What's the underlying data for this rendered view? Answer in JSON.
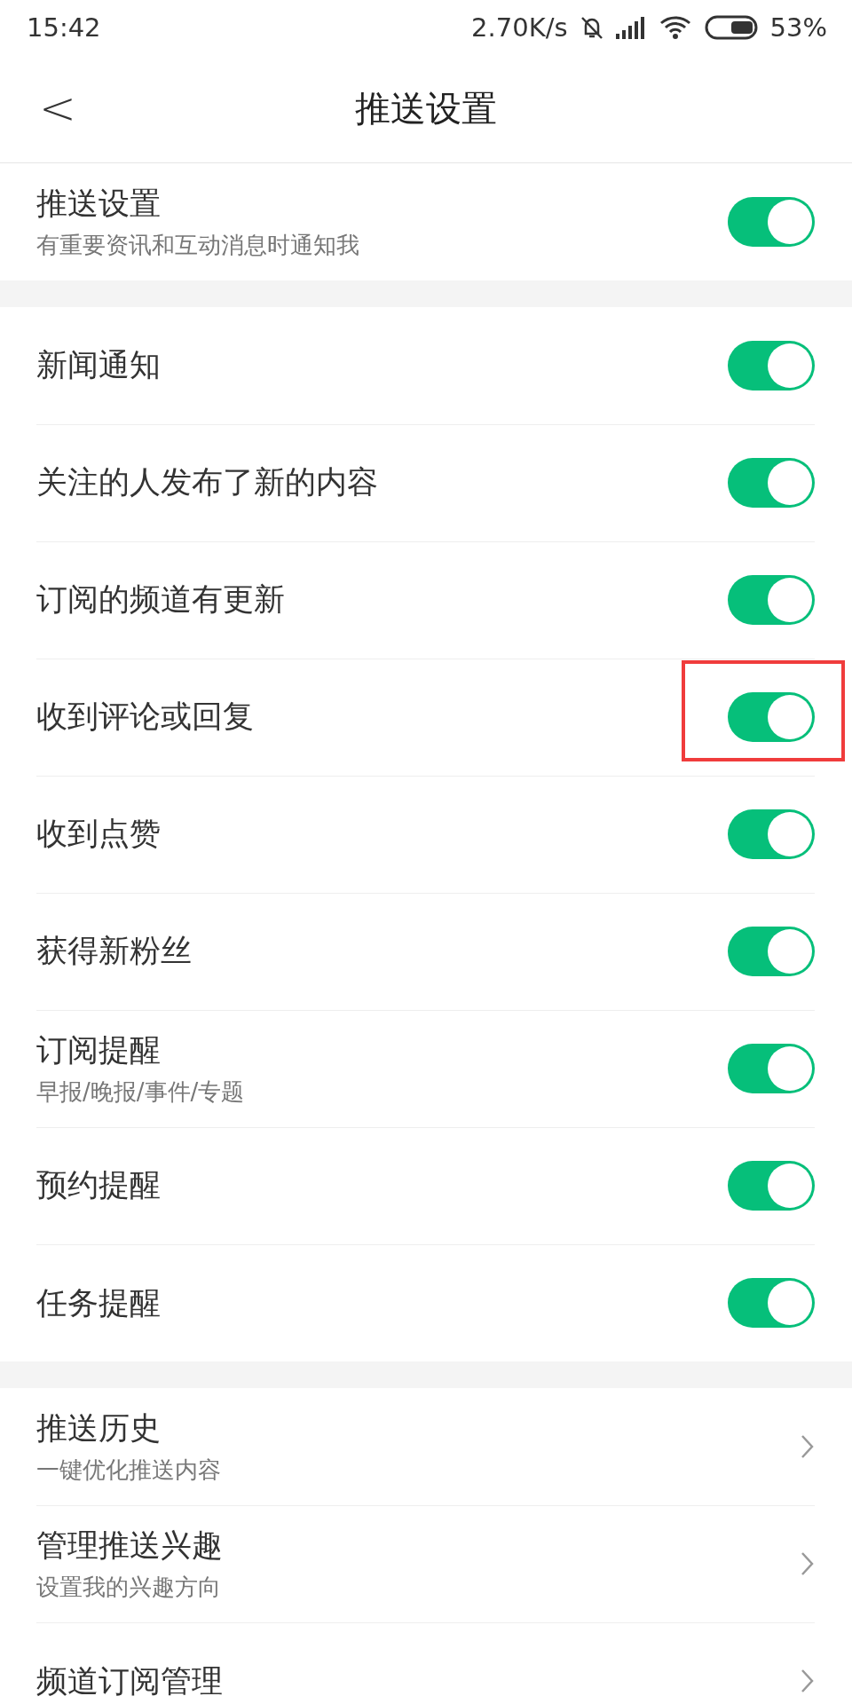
{
  "status_bar": {
    "time": "15:42",
    "speed": "2.70K/s",
    "battery": "53%"
  },
  "header": {
    "back": "<",
    "title": "推送设置"
  },
  "master": {
    "title": "推送设置",
    "subtitle": "有重要资讯和互动消息时通知我",
    "on": true
  },
  "toggles": [
    {
      "title": "新闻通知",
      "on": true,
      "highlighted": false
    },
    {
      "title": "关注的人发布了新的内容",
      "on": true,
      "highlighted": false
    },
    {
      "title": "订阅的频道有更新",
      "on": true,
      "highlighted": false
    },
    {
      "title": "收到评论或回复",
      "on": true,
      "highlighted": true
    },
    {
      "title": "收到点赞",
      "on": true,
      "highlighted": false
    },
    {
      "title": "获得新粉丝",
      "on": true,
      "highlighted": false
    },
    {
      "title": "订阅提醒",
      "subtitle": "早报/晚报/事件/专题",
      "on": true,
      "highlighted": false
    },
    {
      "title": "预约提醒",
      "on": true,
      "highlighted": false
    },
    {
      "title": "任务提醒",
      "on": true,
      "highlighted": false
    }
  ],
  "links": [
    {
      "title": "推送历史",
      "subtitle": "一键优化推送内容"
    },
    {
      "title": "管理推送兴趣",
      "subtitle": "设置我的兴趣方向"
    },
    {
      "title": "频道订阅管理"
    }
  ]
}
